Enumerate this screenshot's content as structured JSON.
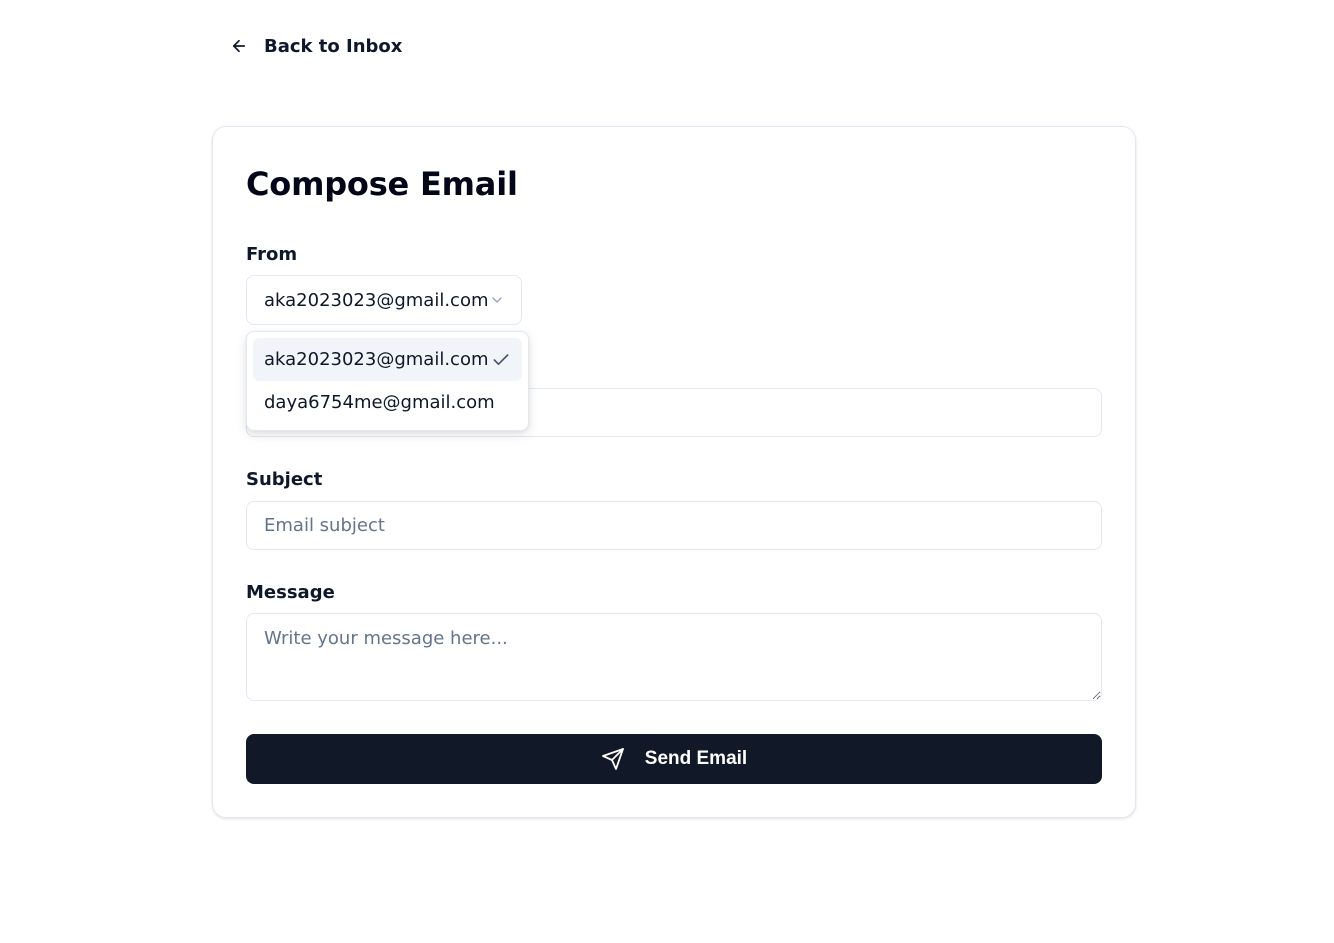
{
  "nav": {
    "back_label": "Back to Inbox"
  },
  "card": {
    "title": "Compose Email"
  },
  "from": {
    "label": "From",
    "selected": "aka2023023@gmail.com",
    "options": [
      "aka2023023@gmail.com",
      "daya6754me@gmail.com"
    ]
  },
  "to": {
    "value": ""
  },
  "subject": {
    "label": "Subject",
    "placeholder": "Email subject"
  },
  "message": {
    "label": "Message",
    "placeholder": "Write your message here..."
  },
  "send": {
    "label": "Send Email"
  },
  "icons": {
    "back": "arrow-left-icon",
    "chevron": "chevron-down-icon",
    "check": "check-icon",
    "send": "send-icon"
  },
  "colors": {
    "primary_button": "#111827",
    "border": "#e2e8f0",
    "placeholder": "#64748b",
    "selected_option_bg": "#f1f5f9"
  }
}
